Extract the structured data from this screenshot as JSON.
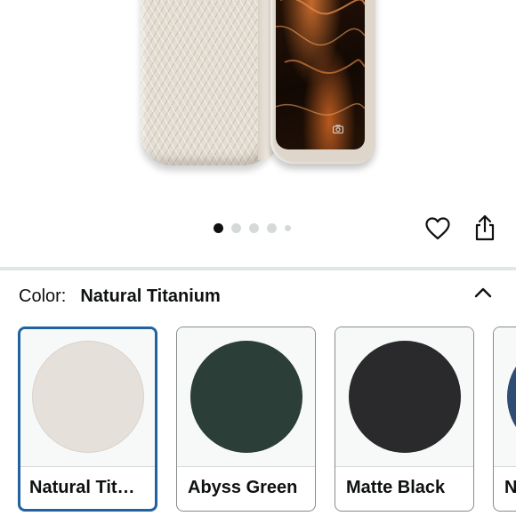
{
  "gallery": {
    "dot_count": 5,
    "active_index": 0
  },
  "actions": {
    "favorite_icon": "heart-icon",
    "share_icon": "share-icon"
  },
  "color_selector": {
    "label": "Color:",
    "selected_value": "Natural Titanium",
    "collapse_icon": "chevron-up-icon",
    "accent_color": "#2162a1",
    "options": [
      {
        "name": "Natural Tit…",
        "swatch": "#e6e0da",
        "selected": true
      },
      {
        "name": "Abyss Green",
        "swatch": "#2c3e38",
        "selected": false
      },
      {
        "name": "Matte Black",
        "swatch": "#2a2a2c",
        "selected": false
      },
      {
        "name": "N",
        "swatch": "#2f4d74",
        "selected": false
      }
    ]
  }
}
